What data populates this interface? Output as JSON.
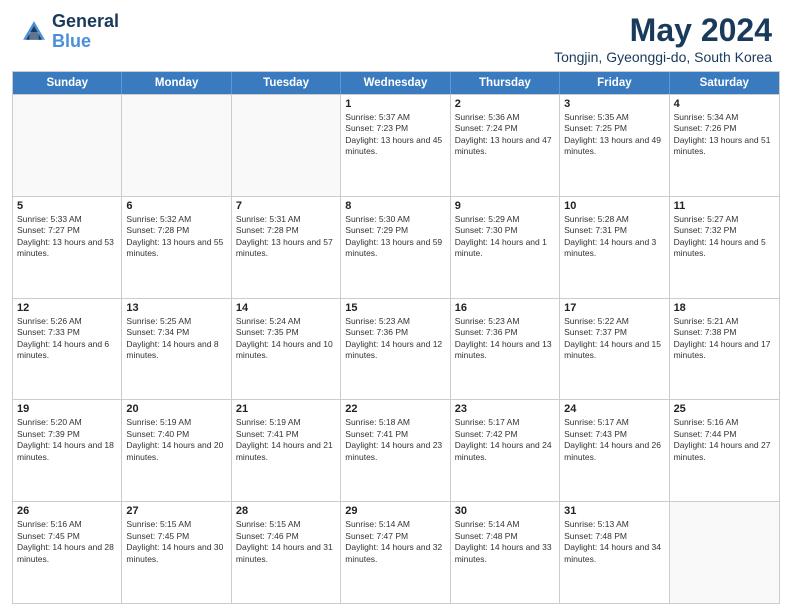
{
  "header": {
    "logo_line1": "General",
    "logo_line2": "Blue",
    "title": "May 2024",
    "subtitle": "Tongjin, Gyeonggi-do, South Korea"
  },
  "calendar": {
    "days_of_week": [
      "Sunday",
      "Monday",
      "Tuesday",
      "Wednesday",
      "Thursday",
      "Friday",
      "Saturday"
    ],
    "weeks": [
      [
        {
          "day": "",
          "sunrise": "",
          "sunset": "",
          "daylight": ""
        },
        {
          "day": "",
          "sunrise": "",
          "sunset": "",
          "daylight": ""
        },
        {
          "day": "",
          "sunrise": "",
          "sunset": "",
          "daylight": ""
        },
        {
          "day": "1",
          "sunrise": "Sunrise: 5:37 AM",
          "sunset": "Sunset: 7:23 PM",
          "daylight": "Daylight: 13 hours and 45 minutes."
        },
        {
          "day": "2",
          "sunrise": "Sunrise: 5:36 AM",
          "sunset": "Sunset: 7:24 PM",
          "daylight": "Daylight: 13 hours and 47 minutes."
        },
        {
          "day": "3",
          "sunrise": "Sunrise: 5:35 AM",
          "sunset": "Sunset: 7:25 PM",
          "daylight": "Daylight: 13 hours and 49 minutes."
        },
        {
          "day": "4",
          "sunrise": "Sunrise: 5:34 AM",
          "sunset": "Sunset: 7:26 PM",
          "daylight": "Daylight: 13 hours and 51 minutes."
        }
      ],
      [
        {
          "day": "5",
          "sunrise": "Sunrise: 5:33 AM",
          "sunset": "Sunset: 7:27 PM",
          "daylight": "Daylight: 13 hours and 53 minutes."
        },
        {
          "day": "6",
          "sunrise": "Sunrise: 5:32 AM",
          "sunset": "Sunset: 7:28 PM",
          "daylight": "Daylight: 13 hours and 55 minutes."
        },
        {
          "day": "7",
          "sunrise": "Sunrise: 5:31 AM",
          "sunset": "Sunset: 7:28 PM",
          "daylight": "Daylight: 13 hours and 57 minutes."
        },
        {
          "day": "8",
          "sunrise": "Sunrise: 5:30 AM",
          "sunset": "Sunset: 7:29 PM",
          "daylight": "Daylight: 13 hours and 59 minutes."
        },
        {
          "day": "9",
          "sunrise": "Sunrise: 5:29 AM",
          "sunset": "Sunset: 7:30 PM",
          "daylight": "Daylight: 14 hours and 1 minute."
        },
        {
          "day": "10",
          "sunrise": "Sunrise: 5:28 AM",
          "sunset": "Sunset: 7:31 PM",
          "daylight": "Daylight: 14 hours and 3 minutes."
        },
        {
          "day": "11",
          "sunrise": "Sunrise: 5:27 AM",
          "sunset": "Sunset: 7:32 PM",
          "daylight": "Daylight: 14 hours and 5 minutes."
        }
      ],
      [
        {
          "day": "12",
          "sunrise": "Sunrise: 5:26 AM",
          "sunset": "Sunset: 7:33 PM",
          "daylight": "Daylight: 14 hours and 6 minutes."
        },
        {
          "day": "13",
          "sunrise": "Sunrise: 5:25 AM",
          "sunset": "Sunset: 7:34 PM",
          "daylight": "Daylight: 14 hours and 8 minutes."
        },
        {
          "day": "14",
          "sunrise": "Sunrise: 5:24 AM",
          "sunset": "Sunset: 7:35 PM",
          "daylight": "Daylight: 14 hours and 10 minutes."
        },
        {
          "day": "15",
          "sunrise": "Sunrise: 5:23 AM",
          "sunset": "Sunset: 7:36 PM",
          "daylight": "Daylight: 14 hours and 12 minutes."
        },
        {
          "day": "16",
          "sunrise": "Sunrise: 5:23 AM",
          "sunset": "Sunset: 7:36 PM",
          "daylight": "Daylight: 14 hours and 13 minutes."
        },
        {
          "day": "17",
          "sunrise": "Sunrise: 5:22 AM",
          "sunset": "Sunset: 7:37 PM",
          "daylight": "Daylight: 14 hours and 15 minutes."
        },
        {
          "day": "18",
          "sunrise": "Sunrise: 5:21 AM",
          "sunset": "Sunset: 7:38 PM",
          "daylight": "Daylight: 14 hours and 17 minutes."
        }
      ],
      [
        {
          "day": "19",
          "sunrise": "Sunrise: 5:20 AM",
          "sunset": "Sunset: 7:39 PM",
          "daylight": "Daylight: 14 hours and 18 minutes."
        },
        {
          "day": "20",
          "sunrise": "Sunrise: 5:19 AM",
          "sunset": "Sunset: 7:40 PM",
          "daylight": "Daylight: 14 hours and 20 minutes."
        },
        {
          "day": "21",
          "sunrise": "Sunrise: 5:19 AM",
          "sunset": "Sunset: 7:41 PM",
          "daylight": "Daylight: 14 hours and 21 minutes."
        },
        {
          "day": "22",
          "sunrise": "Sunrise: 5:18 AM",
          "sunset": "Sunset: 7:41 PM",
          "daylight": "Daylight: 14 hours and 23 minutes."
        },
        {
          "day": "23",
          "sunrise": "Sunrise: 5:17 AM",
          "sunset": "Sunset: 7:42 PM",
          "daylight": "Daylight: 14 hours and 24 minutes."
        },
        {
          "day": "24",
          "sunrise": "Sunrise: 5:17 AM",
          "sunset": "Sunset: 7:43 PM",
          "daylight": "Daylight: 14 hours and 26 minutes."
        },
        {
          "day": "25",
          "sunrise": "Sunrise: 5:16 AM",
          "sunset": "Sunset: 7:44 PM",
          "daylight": "Daylight: 14 hours and 27 minutes."
        }
      ],
      [
        {
          "day": "26",
          "sunrise": "Sunrise: 5:16 AM",
          "sunset": "Sunset: 7:45 PM",
          "daylight": "Daylight: 14 hours and 28 minutes."
        },
        {
          "day": "27",
          "sunrise": "Sunrise: 5:15 AM",
          "sunset": "Sunset: 7:45 PM",
          "daylight": "Daylight: 14 hours and 30 minutes."
        },
        {
          "day": "28",
          "sunrise": "Sunrise: 5:15 AM",
          "sunset": "Sunset: 7:46 PM",
          "daylight": "Daylight: 14 hours and 31 minutes."
        },
        {
          "day": "29",
          "sunrise": "Sunrise: 5:14 AM",
          "sunset": "Sunset: 7:47 PM",
          "daylight": "Daylight: 14 hours and 32 minutes."
        },
        {
          "day": "30",
          "sunrise": "Sunrise: 5:14 AM",
          "sunset": "Sunset: 7:48 PM",
          "daylight": "Daylight: 14 hours and 33 minutes."
        },
        {
          "day": "31",
          "sunrise": "Sunrise: 5:13 AM",
          "sunset": "Sunset: 7:48 PM",
          "daylight": "Daylight: 14 hours and 34 minutes."
        },
        {
          "day": "",
          "sunrise": "",
          "sunset": "",
          "daylight": ""
        }
      ]
    ]
  }
}
